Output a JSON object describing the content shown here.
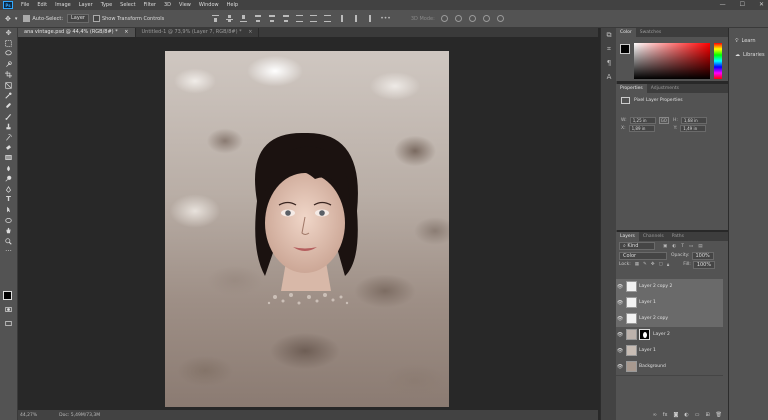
{
  "app": {
    "logo": "Ps"
  },
  "menu": [
    "File",
    "Edit",
    "Image",
    "Layer",
    "Type",
    "Select",
    "Filter",
    "3D",
    "View",
    "Window",
    "Help"
  ],
  "window_controls": [
    "—",
    "☐",
    "✕"
  ],
  "options": {
    "auto_select_label": "Auto-Select:",
    "auto_select_value": "Layer",
    "transform_label": "Show Transform Controls",
    "mode_3d": "3D Mode:"
  },
  "tabs": [
    {
      "label": "ana vintage.psd @ 44,4% (RGB/8#) *",
      "active": true
    },
    {
      "label": "Untitled-1 @ 73,9% (Layer 7, RGB/8#) *",
      "active": false
    }
  ],
  "color_panel": {
    "tabs": [
      "Color",
      "Swatches"
    ]
  },
  "properties": {
    "tabs": [
      "Properties",
      "Adjustments"
    ],
    "title": "Pixel Layer Properties",
    "w_label": "W:",
    "w": "1,25 in",
    "h_label": "H:",
    "h": "1,68 in",
    "x_label": "X:",
    "x": "1,89 in",
    "y_label": "Y:",
    "y": "1,49 in",
    "link": "GO"
  },
  "layers_panel": {
    "tabs": [
      "Layers",
      "Channels",
      "Paths"
    ],
    "filter": "Kind",
    "blend_mode": "Color",
    "opacity_label": "Opacity:",
    "opacity": "100%",
    "lock_label": "Lock:",
    "fill_label": "Fill:",
    "fill": "100%",
    "layers": [
      {
        "name": "Layer 2 copy 2",
        "selected": true
      },
      {
        "name": "Layer 1",
        "selected": true
      },
      {
        "name": "Layer 2 copy",
        "selected": true
      },
      {
        "name": "Layer 2",
        "selected": false,
        "has_mask": true
      },
      {
        "name": "Layer 1",
        "selected": false
      },
      {
        "name": "Background",
        "selected": false
      }
    ]
  },
  "right_dock": {
    "learn": "Learn",
    "libraries": "Libraries"
  },
  "status": {
    "zoom": "44,27%",
    "doc": "Doc: 5,49M/73,3M"
  }
}
